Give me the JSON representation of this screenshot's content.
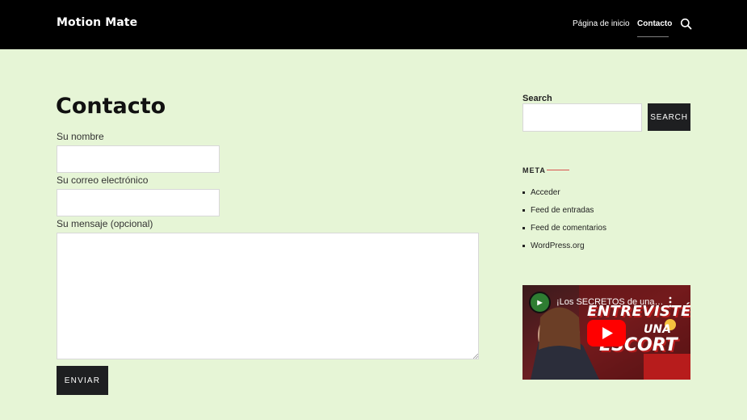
{
  "header": {
    "brand": "Motion Mate",
    "nav": [
      {
        "label": "Página de inicio"
      },
      {
        "label": "Contacto"
      }
    ]
  },
  "form": {
    "title": "Contacto",
    "name_label": "Su nombre",
    "email_label": "Su correo electrónico",
    "message_label": "Su mensaje (opcional)",
    "submit_label": "ENVIAR"
  },
  "sidebar": {
    "search_label": "Search",
    "search_button": "SEARCH",
    "meta_title": "META",
    "meta_items": [
      "Acceder",
      "Feed de entradas",
      "Feed de comentarios",
      "WordPress.org"
    ]
  },
  "video": {
    "title": "¡Los SECRETOS de una Escort",
    "overlay_line1": "ENTREVISTÉ",
    "overlay_line2": "UNA",
    "overlay_line3": "ESCORT"
  },
  "colors": {
    "page_bg": "#e6f5d6",
    "header_bg": "#000000",
    "button_bg": "#1e1f21",
    "accent_line": "#d9534f"
  }
}
